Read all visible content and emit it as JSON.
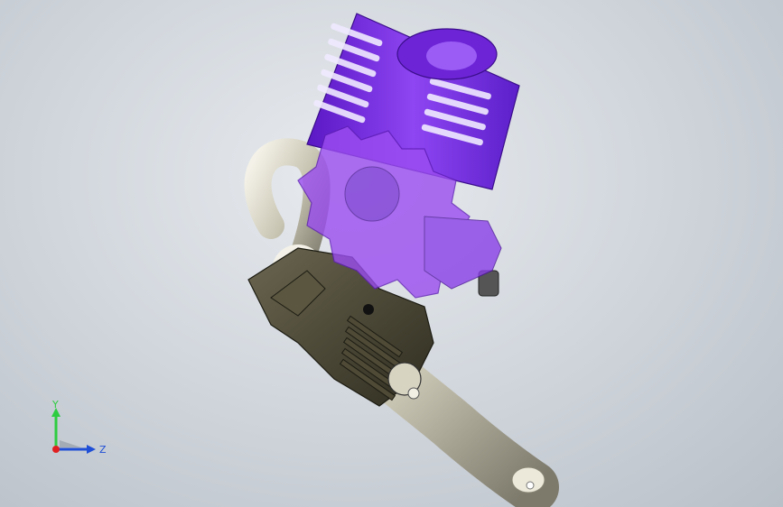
{
  "viewport": {
    "background_top": "#e8ebef",
    "background_bottom": "#b9c0c8"
  },
  "model": {
    "parts": [
      {
        "name": "cylinder-head",
        "color": "#7a2fe0"
      },
      {
        "name": "crankcase",
        "color": "#4a4632"
      },
      {
        "name": "exhaust-pipe",
        "color": "#c9c5b3"
      },
      {
        "name": "clutch-bell-gear",
        "color": "#9b4df0"
      }
    ]
  },
  "triad": {
    "y_label": "Y",
    "z_label": "Z",
    "y_color": "#2ecc40",
    "z_color": "#1f4fd6",
    "x_color": "#e02020"
  }
}
